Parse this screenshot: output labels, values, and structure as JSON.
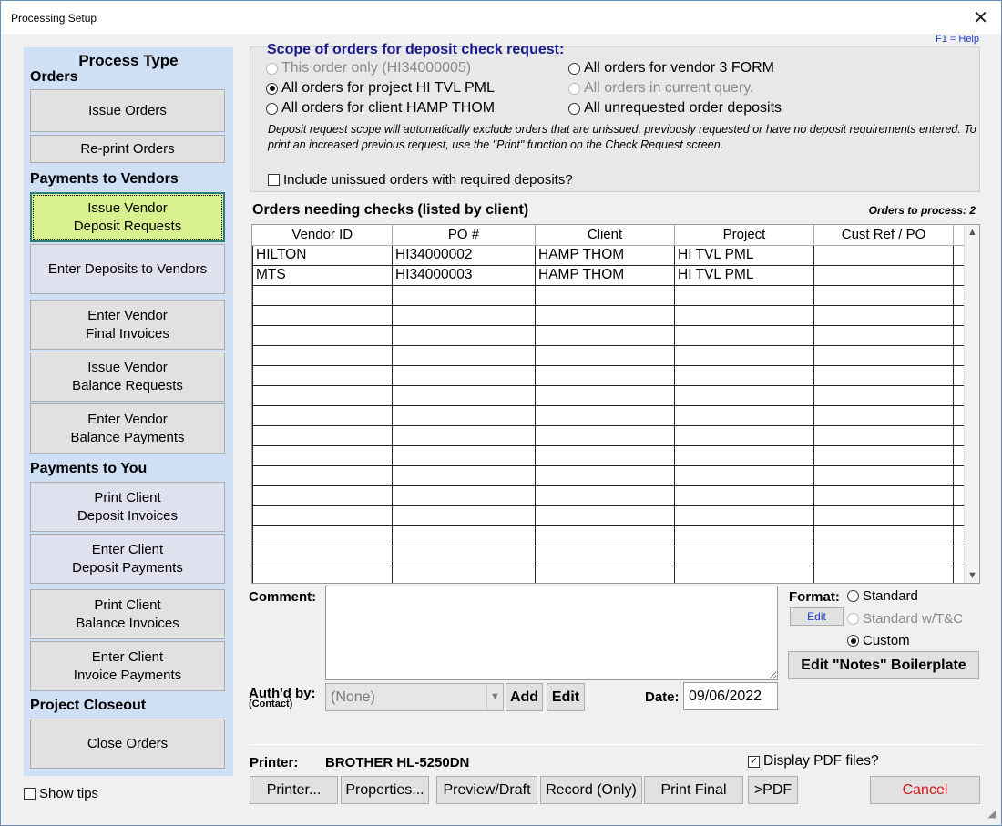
{
  "window": {
    "title": "Processing Setup",
    "close_glyph": "✕",
    "help": "F1 = Help"
  },
  "left": {
    "title": "Process Type",
    "sections": {
      "orders": "Orders",
      "vendors": "Payments to Vendors",
      "you": "Payments to You",
      "closeout": "Project Closeout"
    },
    "buttons": {
      "issue_orders": "Issue Orders",
      "reprint_orders": "Re-print Orders",
      "issue_vendor_deposit": "Issue Vendor\nDeposit Requests",
      "enter_deposits_vendors": "Enter Deposits to Vendors",
      "enter_vendor_final": "Enter Vendor\nFinal Invoices",
      "issue_vendor_balance": "Issue Vendor\nBalance Requests",
      "enter_vendor_balance": "Enter Vendor\nBalance Payments",
      "print_client_deposit": "Print Client\nDeposit Invoices",
      "enter_client_deposit": "Enter Client\nDeposit Payments",
      "print_client_balance": "Print Client\nBalance Invoices",
      "enter_client_invoice": "Enter Client\nInvoice Payments",
      "close_orders": "Close Orders"
    },
    "show_tips": "Show tips"
  },
  "scope": {
    "title": "Scope of orders for deposit check request:",
    "options": {
      "this_order": "This order only (HI34000005)",
      "project": "All orders for project HI TVL PML",
      "client": "All orders for client HAMP THOM",
      "vendor": "All orders for vendor 3 FORM",
      "query": "All orders in current query.",
      "unrequested": "All unrequested order deposits"
    },
    "selected": "project",
    "note": "Deposit request scope will automatically exclude orders that are unissued, previously requested or have no deposit requirements entered. To print an increased previous request, use the \"Print\" function on the Check Request screen.",
    "include_unissued": "Include unissued orders with required deposits?"
  },
  "grid": {
    "title": "Orders needing checks (listed by client)",
    "count": "Orders to process: 2",
    "columns": [
      "Vendor ID",
      "PO #",
      "Client",
      "Project",
      "Cust Ref / PO"
    ],
    "rows": [
      [
        "HILTON",
        "HI34000002",
        "HAMP THOM",
        "HI TVL PML",
        ""
      ],
      [
        "MTS",
        "HI34000003",
        "HAMP THOM",
        "HI TVL PML",
        ""
      ]
    ],
    "empty_rows": 15
  },
  "form": {
    "comment_label": "Comment:",
    "format_label": "Format:",
    "format_options": {
      "standard": "Standard",
      "standard_tc": "Standard w/T&C",
      "custom": "Custom"
    },
    "format_selected": "custom",
    "format_edit": "Edit",
    "boilerplate": "Edit \"Notes\" Boilerplate",
    "auth_label": "Auth'd by:",
    "auth_sub": "(Contact)",
    "auth_value": "(None)",
    "add": "Add",
    "edit": "Edit",
    "date_label": "Date:",
    "date_value": "09/06/2022"
  },
  "bottom": {
    "printer_label": "Printer:",
    "printer_name": "BROTHER HL-5250DN",
    "display_pdf": "Display PDF files?",
    "display_pdf_checked": true,
    "buttons": {
      "printer": "Printer...",
      "properties": "Properties...",
      "preview": "Preview/Draft",
      "record": "Record (Only)",
      "print_final": "Print Final",
      "pdf": ">PDF",
      "cancel": "Cancel"
    }
  }
}
